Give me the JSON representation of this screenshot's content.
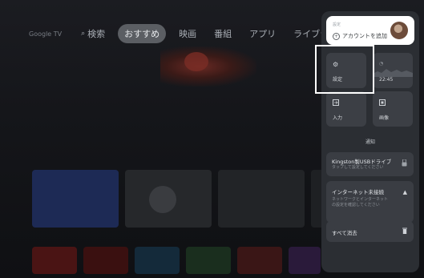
{
  "nav": {
    "brand": "Google TV",
    "search_label": "検索",
    "tabs": [
      "おすすめ",
      "映画",
      "番組",
      "アプリ",
      "ライブラリ"
    ],
    "active_tab": "おすすめ"
  },
  "panel": {
    "account": {
      "name": "設定",
      "add_label": "アカウントを追加"
    },
    "tiles": [
      {
        "label": "設定",
        "icon": "gear-icon"
      },
      {
        "label": "22:45",
        "icon": "clock-icon"
      },
      {
        "label": "入力",
        "icon": "input-icon"
      },
      {
        "label": "画像",
        "icon": "picture-icon"
      }
    ],
    "notifications_header": "通知",
    "notifications": [
      {
        "title": "Kingston製USBドライブ",
        "subtitle": "タップして設定してください",
        "icon": "usb-icon"
      },
      {
        "title": "インターネット未接続",
        "subtitle_lines": [
          "ネットワークとインターネット",
          "の設定を確認してください"
        ],
        "icon": "warning-icon"
      }
    ],
    "clear_all_label": "すべて消去"
  },
  "colors": {
    "panel_bg": "#2b2e33",
    "tile_bg": "#3c3f45",
    "focus": "#ffffff",
    "active_tab_bg": "#5b5e63"
  }
}
